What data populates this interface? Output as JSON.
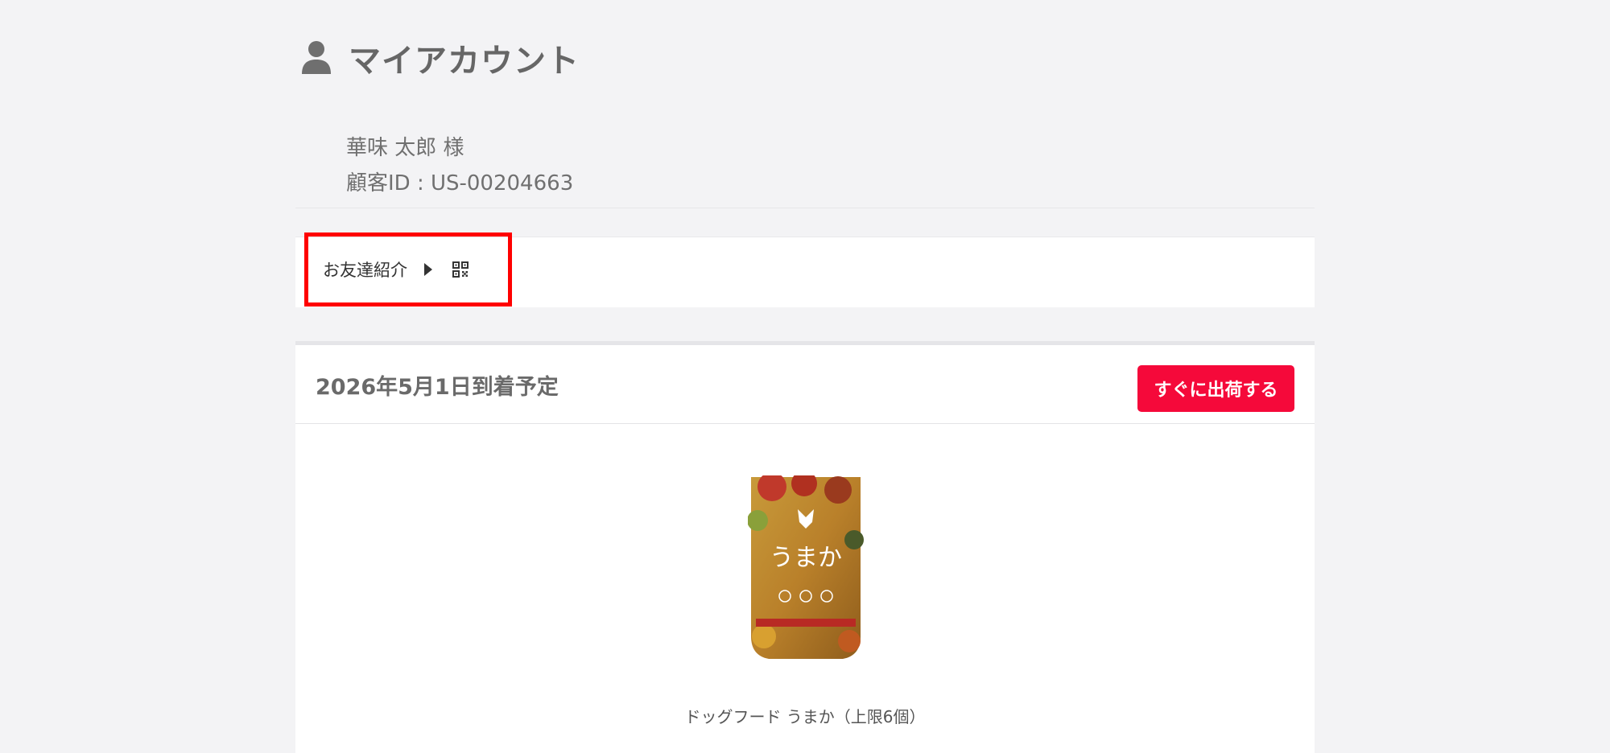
{
  "header": {
    "title": "マイアカウント",
    "icon": "user-icon"
  },
  "account": {
    "customer_name": "華味 太郎 様",
    "customer_id": "顧客ID : US-00204663"
  },
  "referral": {
    "label": "お友達紹介",
    "icons": [
      "caret-right-icon",
      "qr-code-icon"
    ]
  },
  "delivery": {
    "date_label": "2026年5月1日到着予定",
    "ship_button_label": "すぐに出荷する",
    "product": {
      "name": "ドッグフード うまか（上限6個）",
      "package_text": "うまか"
    }
  },
  "colors": {
    "accent_red": "#f5093a",
    "highlight_border": "#ff0000",
    "background": "#f3f3f5"
  }
}
